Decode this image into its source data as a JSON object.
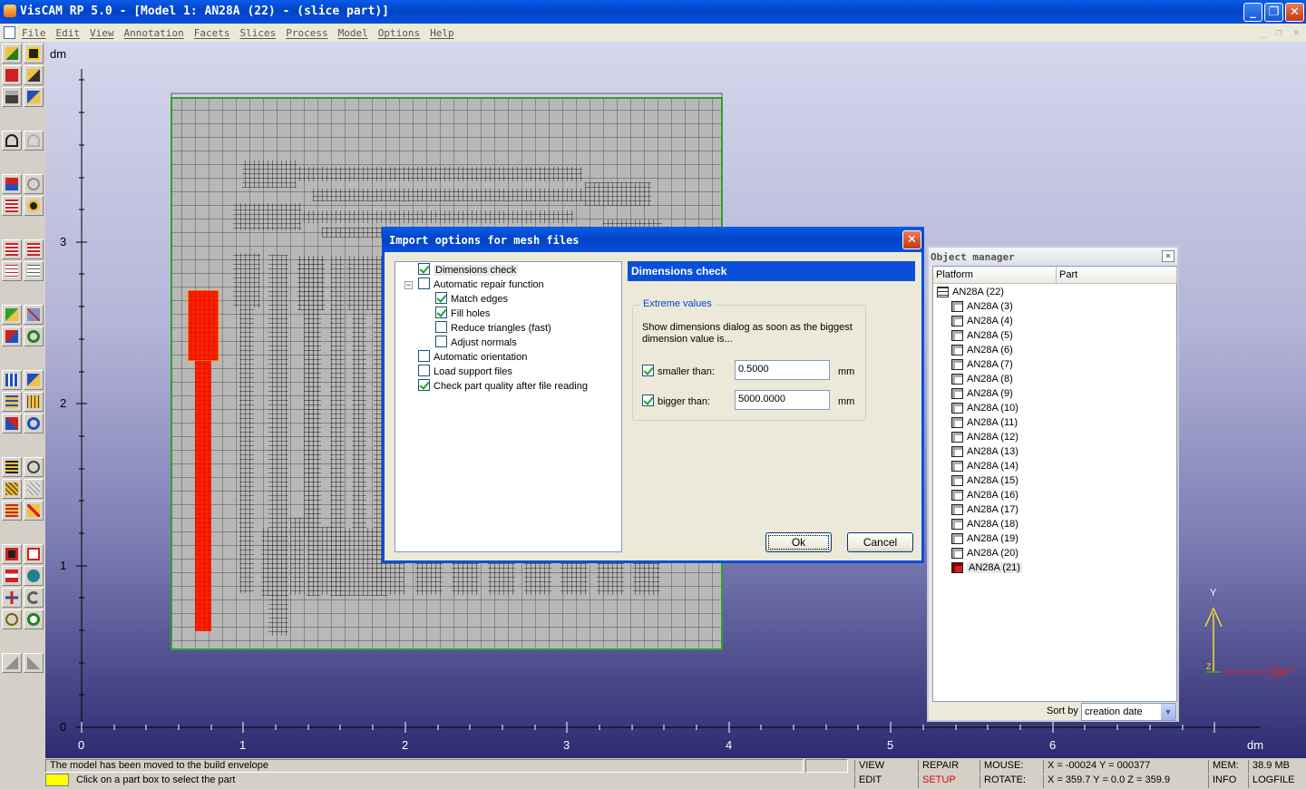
{
  "window": {
    "title": "VisCAM RP 5.0 - [Model 1: AN28A (22) - (slice part)]",
    "min": "_",
    "max": "❐",
    "close": "✕"
  },
  "menu": [
    "File",
    "Edit",
    "View",
    "Annotation",
    "Facets",
    "Slices",
    "Process",
    "Model",
    "Options",
    "Help"
  ],
  "mdi": {
    "min": "_",
    "restore": "❐",
    "close": "✕"
  },
  "view": {
    "unit_top": "dm",
    "unit_bottom": "dm",
    "y_ticks": [
      "0",
      "1",
      "2",
      "3"
    ],
    "x_ticks": [
      "0",
      "1",
      "2",
      "3",
      "4",
      "5",
      "6"
    ],
    "axis_x": "X",
    "axis_y": "Y",
    "axis_z": "Z"
  },
  "dialog": {
    "title": "Import options for mesh files",
    "close": "✕",
    "tree": [
      {
        "label": "Dimensions check",
        "checked": true
      },
      {
        "label": "Automatic repair function",
        "checked": false
      },
      {
        "label": "Match edges",
        "checked": true
      },
      {
        "label": "Fill holes",
        "checked": true
      },
      {
        "label": "Reduce triangles (fast)",
        "checked": false
      },
      {
        "label": "Adjust normals",
        "checked": false
      },
      {
        "label": "Automatic orientation",
        "checked": false
      },
      {
        "label": "Load support files",
        "checked": false
      },
      {
        "label": "Check part quality after file reading",
        "checked": true
      }
    ],
    "expander": "−",
    "panel_title": "Dimensions check",
    "group_label": "Extreme values",
    "description": "Show dimensions dialog as soon as the biggest dimension value is...",
    "smaller_label": "smaller than:",
    "smaller_value": "0.5000",
    "bigger_label": "bigger than:",
    "bigger_value": "5000.0000",
    "unit": "mm",
    "ok": "Ok",
    "cancel": "Cancel"
  },
  "object_manager": {
    "title": "Object manager",
    "close": "✕",
    "col_platform": "Platform",
    "col_part": "Part",
    "root": "AN28A (22)",
    "items": [
      "AN28A (3)",
      "AN28A (4)",
      "AN28A (5)",
      "AN28A (6)",
      "AN28A (7)",
      "AN28A (8)",
      "AN28A (9)",
      "AN28A (10)",
      "AN28A (11)",
      "AN28A (12)",
      "AN28A (13)",
      "AN28A (14)",
      "AN28A (15)",
      "AN28A (16)",
      "AN28A (17)",
      "AN28A (18)",
      "AN28A (19)",
      "AN28A (20)",
      "AN28A (21)"
    ],
    "selected_item": "AN28A (21)",
    "sort_label": "Sort by",
    "sort_value": "creation date",
    "sort_arrow": "▼"
  },
  "status": {
    "msg1": "The model has been moved to the build envelope",
    "msg2": "Click on a part box to select the part",
    "view": "VIEW",
    "edit": "EDIT",
    "repair": "REPAIR",
    "setup": "SETUP",
    "mouse_label": "MOUSE:",
    "rotate_label": "ROTATE:",
    "mouse_value": "X = -00024   Y = 000377",
    "rotate_value": "X = 359.7    Y = 0.0    Z = 359.9",
    "mem_label": "MEM:",
    "mem_value": "38.9 MB",
    "info": "INFO",
    "logfile": "LOGFILE",
    "setup_color": "#e00000"
  }
}
